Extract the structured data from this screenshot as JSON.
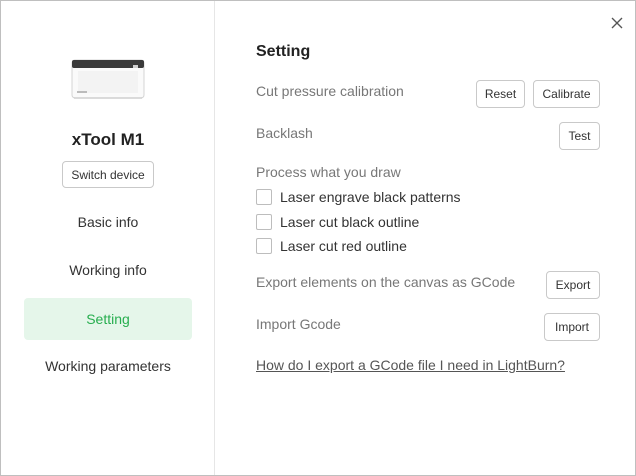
{
  "sidebar": {
    "device_name": "xTool M1",
    "switch_label": "Switch device",
    "items": [
      {
        "label": "Basic info",
        "active": false
      },
      {
        "label": "Working info",
        "active": false
      },
      {
        "label": "Setting",
        "active": true
      },
      {
        "label": "Working parameters",
        "active": false
      }
    ]
  },
  "main": {
    "title": "Setting",
    "cut_pressure": {
      "label": "Cut pressure calibration",
      "reset_label": "Reset",
      "calibrate_label": "Calibrate"
    },
    "backlash": {
      "label": "Backlash",
      "test_label": "Test"
    },
    "process": {
      "label": "Process what you draw",
      "options": [
        {
          "label": "Laser engrave black patterns",
          "checked": false
        },
        {
          "label": "Laser cut black outline",
          "checked": false
        },
        {
          "label": "Laser cut red outline",
          "checked": false
        }
      ]
    },
    "export": {
      "label": "Export elements on the canvas as GCode",
      "button_label": "Export"
    },
    "import": {
      "label": "Import Gcode",
      "button_label": "Import"
    },
    "help_link": "How do I export a GCode file I need in LightBurn?"
  },
  "colors": {
    "accent": "#27ae4f",
    "active_bg": "#e5f6ea",
    "border": "#c9c9c9"
  }
}
